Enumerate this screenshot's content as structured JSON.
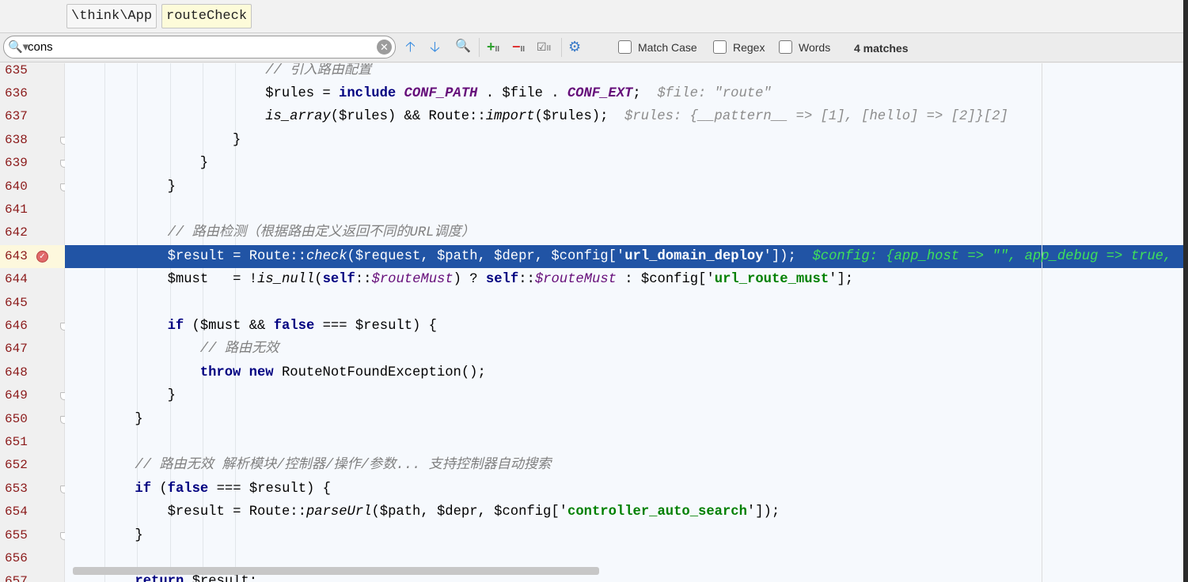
{
  "breadcrumb": [
    "\\think\\App",
    "routeCheck"
  ],
  "find": {
    "query": "cons",
    "options": [
      {
        "label": "Match Case"
      },
      {
        "label": "Regex"
      },
      {
        "label": "Words"
      }
    ],
    "match_count": "4 matches",
    "toolbar_icons": [
      "previous-occurrence-icon",
      "next-occurrence-icon",
      "find-all-icon",
      "add-selection-icon",
      "remove-selection-icon",
      "select-all-occurrences-icon",
      "settings-icon"
    ]
  },
  "colors": {
    "selection": "#2154a5",
    "line_number": "#8b1a1a",
    "keyword": "#000080",
    "string": "#008000",
    "constant": "#660e7a"
  },
  "current_line": 643,
  "breakpoint_line": 643,
  "lines": [
    {
      "n": "635",
      "i": 24,
      "t": [
        [
          "cm",
          "// 引入路由配置"
        ]
      ]
    },
    {
      "n": "636",
      "i": 24,
      "t": [
        [
          "",
          "$rules = "
        ],
        [
          "kw",
          "include"
        ],
        [
          "",
          " "
        ],
        [
          "const",
          "CONF_PATH"
        ],
        [
          "",
          " . $file . "
        ],
        [
          "const",
          "CONF_EXT"
        ],
        [
          "",
          ";  "
        ],
        [
          "dbg",
          "$file: \"route\""
        ]
      ]
    },
    {
      "n": "637",
      "i": 24,
      "t": [
        [
          "fn",
          "is_array"
        ],
        [
          "",
          "($rules) && Route::"
        ],
        [
          "fn",
          "import"
        ],
        [
          "",
          "($rules);  "
        ],
        [
          "dbg",
          "$rules: {__pattern__ => [1], [hello] => [2]}[2]"
        ]
      ]
    },
    {
      "n": "638",
      "i": 20,
      "t": [
        [
          "",
          "}"
        ]
      ],
      "fold": true
    },
    {
      "n": "639",
      "i": 16,
      "t": [
        [
          "",
          "}"
        ]
      ],
      "fold": true
    },
    {
      "n": "640",
      "i": 12,
      "t": [
        [
          "",
          "}"
        ]
      ],
      "fold": true
    },
    {
      "n": "641",
      "i": 0,
      "t": []
    },
    {
      "n": "642",
      "i": 12,
      "t": [
        [
          "cm",
          "// 路由检测（根据路由定义返回不同的URL调度）"
        ]
      ]
    },
    {
      "n": "643",
      "i": 12,
      "t": [
        [
          "",
          "$result = Route::"
        ],
        [
          "fn",
          "check"
        ],
        [
          "",
          "($request, $path, $depr, $config['"
        ],
        [
          "str",
          "url_domain_deploy"
        ],
        [
          "",
          "']);  "
        ],
        [
          "dbg",
          "$config: {app_host => \"\", app_debug => true,"
        ]
      ]
    },
    {
      "n": "644",
      "i": 12,
      "t": [
        [
          "",
          "$must   = !"
        ],
        [
          "fn",
          "is_null"
        ],
        [
          "",
          "("
        ],
        [
          "kw",
          "self"
        ],
        [
          "",
          "::"
        ],
        [
          "sf",
          "$routeMust"
        ],
        [
          "",
          ") ? "
        ],
        [
          "kw",
          "self"
        ],
        [
          "",
          "::"
        ],
        [
          "sf",
          "$routeMust"
        ],
        [
          "",
          " : $config['"
        ],
        [
          "str",
          "url_route_must"
        ],
        [
          "",
          "'];"
        ]
      ]
    },
    {
      "n": "645",
      "i": 0,
      "t": []
    },
    {
      "n": "646",
      "i": 12,
      "t": [
        [
          "kw",
          "if"
        ],
        [
          "",
          " ($must && "
        ],
        [
          "kw",
          "false"
        ],
        [
          "",
          " === $result) {"
        ]
      ],
      "fold": true
    },
    {
      "n": "647",
      "i": 16,
      "t": [
        [
          "cm",
          "// 路由无效"
        ]
      ]
    },
    {
      "n": "648",
      "i": 16,
      "t": [
        [
          "kw",
          "throw new"
        ],
        [
          "",
          " RouteNotFoundException();"
        ]
      ]
    },
    {
      "n": "649",
      "i": 12,
      "t": [
        [
          "",
          "}"
        ]
      ],
      "fold": true
    },
    {
      "n": "650",
      "i": 8,
      "t": [
        [
          "",
          "}"
        ]
      ],
      "fold": true
    },
    {
      "n": "651",
      "i": 0,
      "t": []
    },
    {
      "n": "652",
      "i": 8,
      "t": [
        [
          "cm",
          "// 路由无效 解析模块/控制器/操作/参数... 支持控制器自动搜索"
        ]
      ]
    },
    {
      "n": "653",
      "i": 8,
      "t": [
        [
          "kw",
          "if"
        ],
        [
          "",
          " ("
        ],
        [
          "kw",
          "false"
        ],
        [
          "",
          " === $result) {"
        ]
      ],
      "fold": true
    },
    {
      "n": "654",
      "i": 12,
      "t": [
        [
          "",
          "$result = Route::"
        ],
        [
          "fn",
          "parseUrl"
        ],
        [
          "",
          "($path, $depr, $config['"
        ],
        [
          "str",
          "controller_auto_search"
        ],
        [
          "",
          "']);"
        ]
      ]
    },
    {
      "n": "655",
      "i": 8,
      "t": [
        [
          "",
          "}"
        ]
      ],
      "fold": true
    },
    {
      "n": "656",
      "i": 0,
      "t": []
    },
    {
      "n": "657",
      "i": 8,
      "t": [
        [
          "kw",
          "return"
        ],
        [
          "",
          " $result;"
        ]
      ]
    }
  ]
}
